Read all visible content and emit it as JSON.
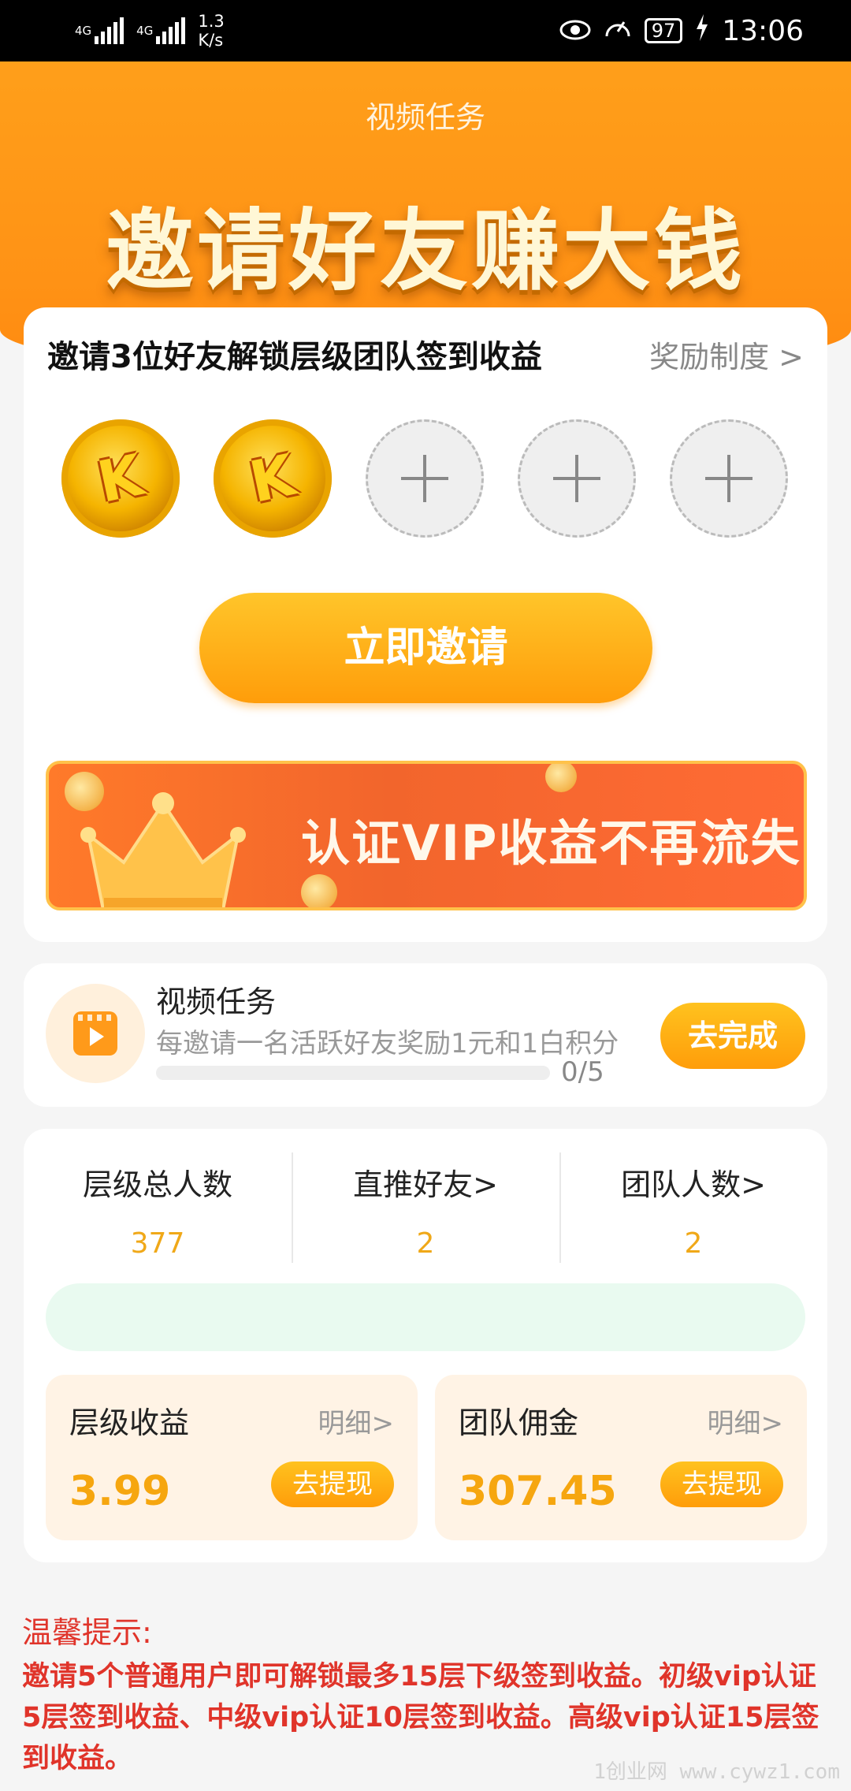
{
  "status_bar": {
    "network1": "4G",
    "network2": "4G",
    "speed_value": "1.3",
    "speed_unit": "K/s",
    "battery": "97",
    "time": "13:06"
  },
  "header": {
    "title": "视频任务",
    "banner": "邀请好友赚大钱"
  },
  "invite": {
    "title": "邀请3位好友解锁层级团队签到收益",
    "reward_link": "奖励制度 >",
    "slots": [
      {
        "type": "coin",
        "glyph": "K"
      },
      {
        "type": "coin",
        "glyph": "K"
      },
      {
        "type": "empty"
      },
      {
        "type": "empty"
      },
      {
        "type": "empty"
      }
    ],
    "button": "立即邀请",
    "vip_banner": "认证VIP收益不再流失"
  },
  "task": {
    "icon": "video-clapper-icon",
    "title": "视频任务",
    "desc": "每邀请一名活跃好友奖励1元和1白积分",
    "progress_fraction": 0,
    "count": "0/5",
    "button": "去完成"
  },
  "stats": {
    "columns": [
      {
        "label": "层级总人数",
        "value": "377"
      },
      {
        "label": "直推好友>",
        "value": "2"
      },
      {
        "label": "团队人数>",
        "value": "2"
      }
    ],
    "earnings": [
      {
        "title": "层级收益",
        "detail": "明细>",
        "value": "3.99",
        "button": "去提现"
      },
      {
        "title": "团队佣金",
        "detail": "明细>",
        "value": "307.45",
        "button": "去提现"
      }
    ]
  },
  "tips": {
    "title": "温馨提示:",
    "body": "邀请5个普通用户即可解锁最多15层下级签到收益。初级vip认证5层签到收益、中级vip认证10层签到收益。高级vip认证15层签到收益。"
  },
  "watermark": "1创业网 www.cywz1.com",
  "colors": {
    "accent": "#ff9d0a",
    "value": "#f6a60f",
    "tips": "#e0342a"
  }
}
